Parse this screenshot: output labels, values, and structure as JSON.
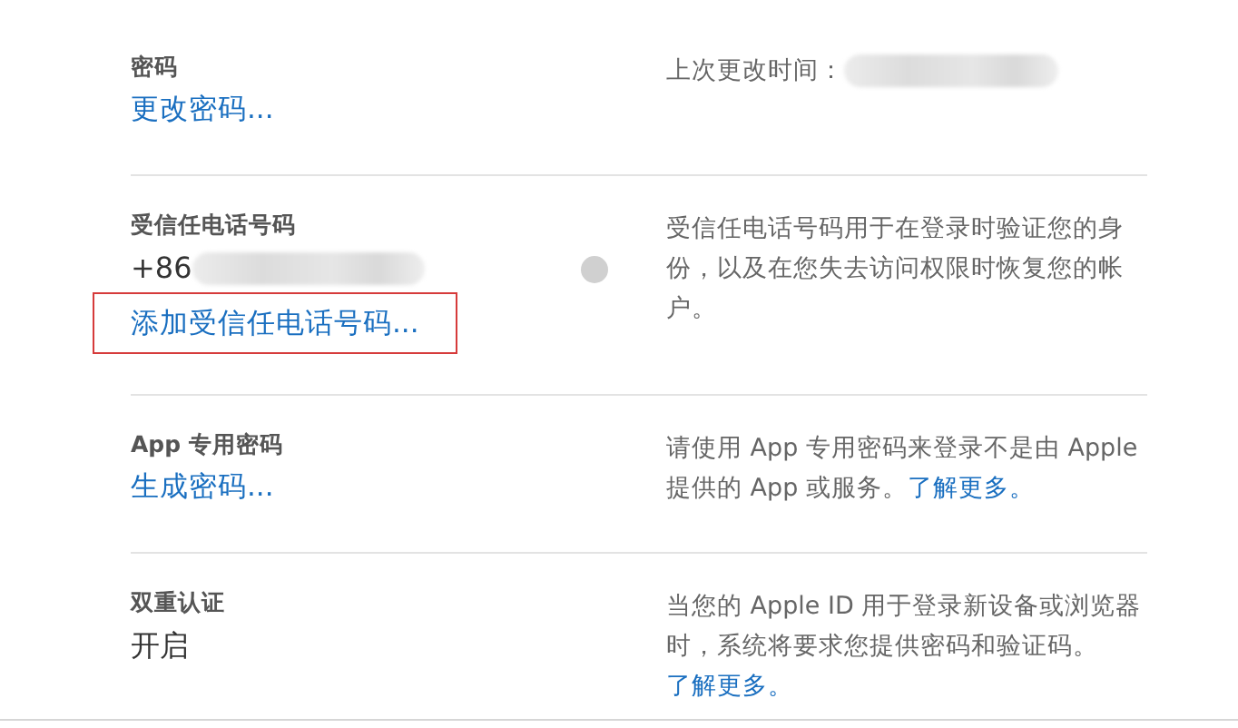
{
  "sections": [
    {
      "label": "密码",
      "kind": "link",
      "value": "更改密码...",
      "description": "上次更改时间：",
      "redacted_description": true
    },
    {
      "label": "受信任电话号码",
      "kind": "phone",
      "value": "+86",
      "redacted_value": true,
      "help_icon": true,
      "extra_link": {
        "text": "添加受信任电话号码...",
        "highlighted": true
      },
      "description": "受信任电话号码用于在登录时验证您的身份，以及在您失去访问权限时恢复您的帐户。"
    },
    {
      "label": "App 专用密码",
      "kind": "link",
      "value": "生成密码...",
      "description": "请使用 App 专用密码来登录不是由 Apple 提供的 App 或服务。",
      "link": "了解更多。"
    },
    {
      "label": "双重认证",
      "kind": "text",
      "value": "开启",
      "description": "当您的 Apple ID 用于登录新设备或浏览器时，系统将要求您提供密码和验证码。",
      "link": "了解更多。",
      "link_on_new_line": true
    }
  ]
}
